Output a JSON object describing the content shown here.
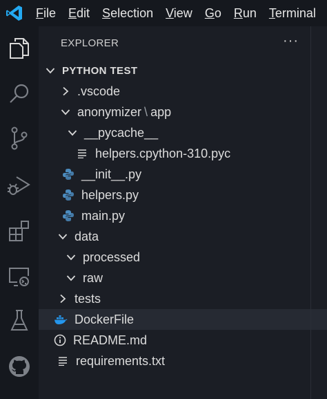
{
  "menu": [
    "File",
    "Edit",
    "Selection",
    "View",
    "Go",
    "Run",
    "Terminal"
  ],
  "activity_icons": [
    "explorer-icon",
    "search-icon",
    "source-control-icon",
    "run-debug-icon",
    "extensions-icon",
    "remote-explorer-icon",
    "testing-icon",
    "github-icon"
  ],
  "explorer": {
    "title": "EXPLORER",
    "more": "···",
    "root": "PYTHON TEST",
    "items": [
      {
        "label": ".vscode",
        "kind": "folder-collapsed",
        "depth": 1
      },
      {
        "label": "anonymizer",
        "label2": "app",
        "sep": "\\",
        "kind": "folder-expanded",
        "depth": 1
      },
      {
        "label": "__pycache__",
        "kind": "folder-expanded",
        "depth": 2
      },
      {
        "label": "helpers.cpython-310.pyc",
        "kind": "lines-file",
        "depth": 3
      },
      {
        "label": "__init__.py",
        "kind": "python-file",
        "depth": 2
      },
      {
        "label": "helpers.py",
        "kind": "python-file",
        "depth": 2
      },
      {
        "label": "main.py",
        "kind": "python-file",
        "depth": 2
      },
      {
        "label": "data",
        "kind": "folder-expanded",
        "depth": 1
      },
      {
        "label": "processed",
        "kind": "folder-expanded",
        "depth": 2
      },
      {
        "label": "raw",
        "kind": "folder-expanded",
        "depth": 2
      },
      {
        "label": "tests",
        "kind": "folder-collapsed",
        "depth": 1
      },
      {
        "label": "DockerFile",
        "kind": "docker-file",
        "depth": 1,
        "selected": true
      },
      {
        "label": "README.md",
        "kind": "info-file",
        "depth": 1
      },
      {
        "label": "requirements.txt",
        "kind": "lines-file",
        "depth": 1
      }
    ]
  },
  "colors": {
    "accent": "#23a9f2",
    "python_blue": "#4b8bbe",
    "python_yellow": "#ffd43b",
    "docker": "#2496ed"
  }
}
